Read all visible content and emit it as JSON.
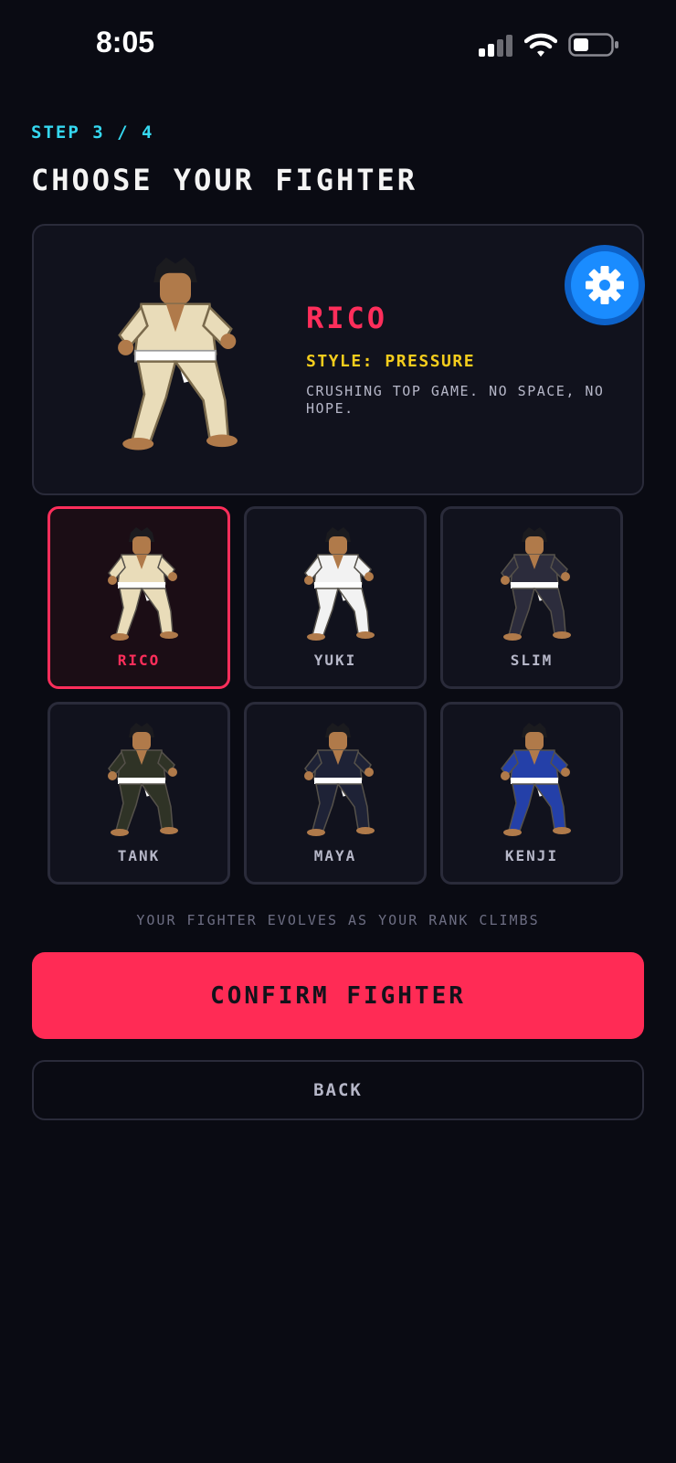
{
  "status": {
    "time": "8:05"
  },
  "header": {
    "step": "STEP 3 / 4",
    "title": "CHOOSE YOUR FIGHTER"
  },
  "hero": {
    "name": "RICO",
    "style": "STYLE: PRESSURE",
    "description": "CRUSHING TOP GAME. NO SPACE, NO HOPE.",
    "gi_color": "#e9dcb9",
    "settings_icon": "gear-icon"
  },
  "fighters": [
    {
      "name": "RICO",
      "gi": "#e9dcb9",
      "belt": "#ffffff",
      "selected": true
    },
    {
      "name": "YUKI",
      "gi": "#f2f2f2",
      "belt": "#ffffff",
      "selected": false
    },
    {
      "name": "SLIM",
      "gi": "#2c2c3c",
      "belt": "#ffffff",
      "selected": false
    },
    {
      "name": "TANK",
      "gi": "#2f3326",
      "belt": "#ffffff",
      "selected": false
    },
    {
      "name": "MAYA",
      "gi": "#1e2236",
      "belt": "#ffffff",
      "selected": false
    },
    {
      "name": "KENJI",
      "gi": "#2440a8",
      "belt": "#ffffff",
      "selected": false
    }
  ],
  "hint": "YOUR FIGHTER EVOLVES AS YOUR RANK CLIMBS",
  "buttons": {
    "confirm": "CONFIRM FIGHTER",
    "back": "BACK"
  },
  "colors": {
    "accent": "#ff2e5b",
    "step": "#35d8f0",
    "style": "#f5cd1d",
    "background": "#0a0b13"
  }
}
